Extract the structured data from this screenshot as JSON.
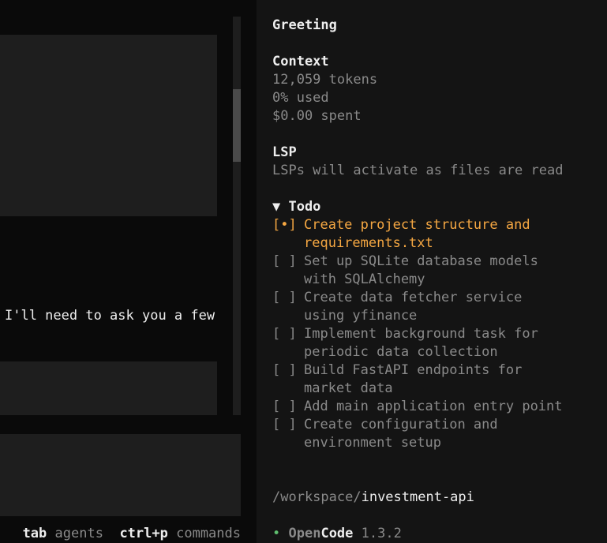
{
  "chat": {
    "partial_message": "I'll need to ask you a few",
    "shortcuts": [
      {
        "key": "tab",
        "desc": "agents"
      },
      {
        "key": "ctrl+p",
        "desc": "commands"
      }
    ]
  },
  "sidebar": {
    "title": "Greeting",
    "context": {
      "heading": "Context",
      "tokens": "12,059 tokens",
      "used": "0% used",
      "spent": "$0.00 spent"
    },
    "lsp": {
      "heading": "LSP",
      "status": "LSPs will activate as files are read"
    },
    "todo": {
      "heading": "▼ Todo",
      "items": [
        {
          "box": "[•]",
          "text": "Create project structure and requirements.txt",
          "state": "in_progress"
        },
        {
          "box": "[ ]",
          "text": "Set up SQLite database models with SQLAlchemy",
          "state": "pending"
        },
        {
          "box": "[ ]",
          "text": "Create data fetcher service using yfinance",
          "state": "pending"
        },
        {
          "box": "[ ]",
          "text": "Implement background task for periodic data collection",
          "state": "pending"
        },
        {
          "box": "[ ]",
          "text": "Build FastAPI endpoints for market data",
          "state": "pending"
        },
        {
          "box": "[ ]",
          "text": "Add main application entry point",
          "state": "pending"
        },
        {
          "box": "[ ]",
          "text": "Create configuration and environment setup",
          "state": "pending"
        }
      ]
    },
    "workspace": {
      "dir": "/workspace/",
      "project": "investment-api"
    },
    "app": {
      "status_dot": "•",
      "name_open": "Open",
      "name_code": "Code",
      "version": "1.3.2"
    }
  },
  "colors": {
    "active_todo": "#f5a742",
    "status_dot": "#5fbf6f",
    "panel_bg": "#1e1e1e",
    "sidebar_bg": "#141414"
  }
}
